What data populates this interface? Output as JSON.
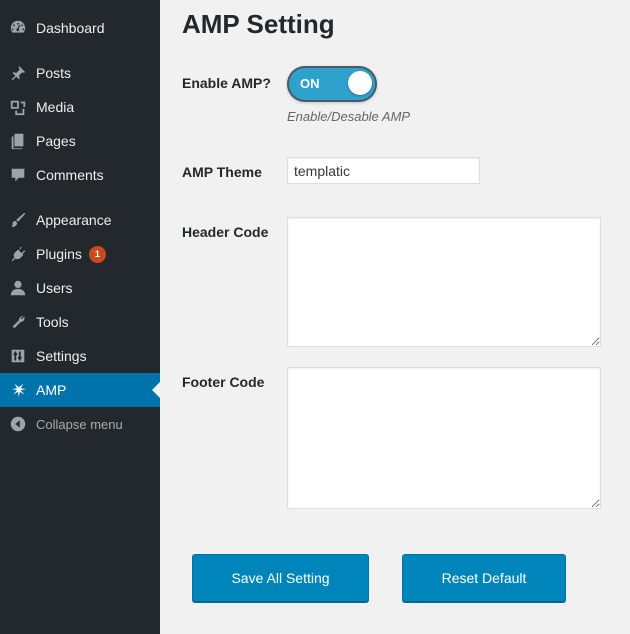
{
  "sidebar": {
    "items": [
      {
        "label": "Dashboard",
        "icon": "dashboard-icon"
      },
      {
        "label": "Posts",
        "icon": "pin-icon"
      },
      {
        "label": "Media",
        "icon": "media-icon"
      },
      {
        "label": "Pages",
        "icon": "pages-icon"
      },
      {
        "label": "Comments",
        "icon": "comment-icon"
      },
      {
        "label": "Appearance",
        "icon": "brush-icon"
      },
      {
        "label": "Plugins",
        "icon": "plug-icon",
        "badge": "1"
      },
      {
        "label": "Users",
        "icon": "user-icon"
      },
      {
        "label": "Tools",
        "icon": "wrench-icon"
      },
      {
        "label": "Settings",
        "icon": "sliders-icon"
      },
      {
        "label": "AMP",
        "icon": "amp-icon",
        "active": true
      }
    ],
    "collapse_label": "Collapse menu"
  },
  "main": {
    "title": "AMP Setting",
    "enable_amp": {
      "label": "Enable AMP?",
      "state_label": "ON",
      "hint": "Enable/Desable AMP"
    },
    "amp_theme": {
      "label": "AMP Theme",
      "value": "templatic"
    },
    "header_code": {
      "label": "Header Code",
      "value": ""
    },
    "footer_code": {
      "label": "Footer Code",
      "value": ""
    },
    "buttons": {
      "save": "Save All Setting",
      "reset": "Reset Default"
    }
  },
  "colors": {
    "sidebar_bg": "#23282d",
    "accent": "#0073aa",
    "button": "#0085ba",
    "toggle": "#2ea2cc",
    "badge": "#ca4a1f"
  }
}
